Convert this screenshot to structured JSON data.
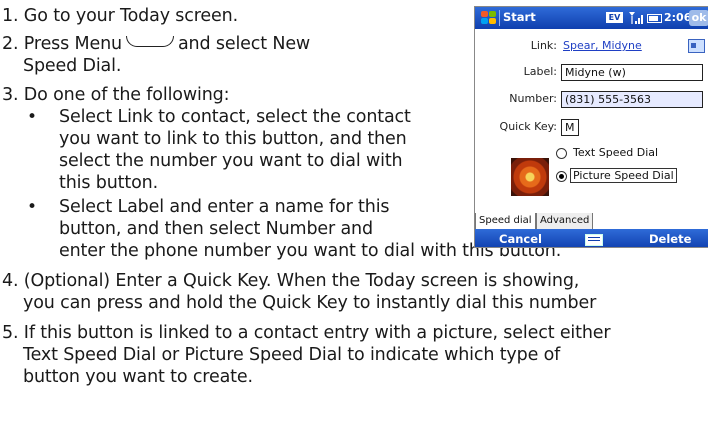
{
  "steps": {
    "s1": "1. Go to your Today screen.",
    "s2a": "2. Press Menu",
    "s2b": "and select New",
    "s2c": "Speed Dial.",
    "s3": "3. Do one of the following:",
    "b1a": "Select Link to contact, select the contact",
    "b1b": "you want to link to this button, and then",
    "b1c": "select the number you want to dial with",
    "b1d": "this button.",
    "b2a": "Select Label and enter a name for this",
    "b2b": "button, and then select Number and",
    "b2c": "enter the phone number you want to dial with this button.",
    "s4a": "4. (Optional) Enter a Quick Key. When the Today screen is showing,",
    "s4b": "you can press and hold the Quick Key to instantly dial this number",
    "s5a": "5. If this button is linked to a contact entry with a picture, select either",
    "s5b": "Text Speed Dial or Picture Speed Dial to indicate which type of",
    "s5c": "button you want to create.",
    "bullet": "•"
  },
  "phone": {
    "title": "Start",
    "ev": "EV",
    "time": "2:06",
    "ok": "ok",
    "link_label": "Link:",
    "link_value": "Spear, Midyne",
    "label_label": "Label:",
    "label_value": "Midyne (w)",
    "number_label": "Number:",
    "number_value": "(831) 555-3563",
    "quickkey_label": "Quick Key:",
    "quickkey_value": "M",
    "radio_text": "Text Speed Dial",
    "radio_picture": "Picture Speed Dial",
    "selected_option": "Picture Speed Dial",
    "tab_speed_dial": "Speed dial",
    "tab_advanced": "Advanced",
    "cancel": "Cancel",
    "delete": "Delete",
    "accent": "#1f4fc4"
  }
}
